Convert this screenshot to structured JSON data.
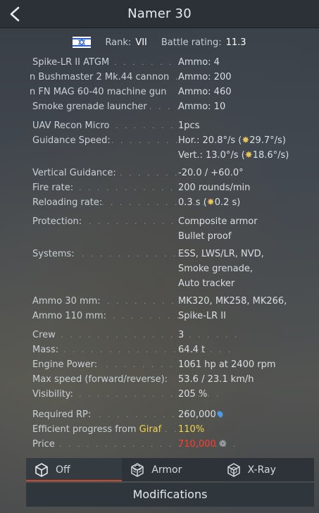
{
  "window": {
    "title": "Namer 30",
    "back_icon": "chevron-left-icon"
  },
  "header": {
    "flag_icon": "israel-flag-icon",
    "rank_label": "Rank:",
    "rank_value": "VII",
    "br_label": "Battle rating:",
    "br_value": "11.3"
  },
  "specs": {
    "weapons": [
      {
        "label": "Spike-LR II ATGM",
        "value": "Ammo:  4"
      },
      {
        "label": "n Bushmaster 2 Mk.44 cannon",
        "value": "Ammo:  200"
      },
      {
        "label": "n FN MAG 60-40 machine gun",
        "value": "Ammo:  460"
      },
      {
        "label": "Smoke grenade launcher",
        "value": "Ammo:  10"
      }
    ],
    "uav": {
      "label": "UAV Recon Micro",
      "value": "1pcs"
    },
    "guidance_speed": {
      "label": "Guidance Speed:",
      "value1": "Hor.: 20.8°/s (",
      "value1_b": "29.7°/s)",
      "value2": "Vert.: 13.0°/s (",
      "value2_b": "18.6°/s)"
    },
    "vertical_guidance": {
      "label": "Vertical Guidance:",
      "value": "-20.0 / +60.0°"
    },
    "fire_rate": {
      "label": "Fire rate:",
      "value": "200 rounds/min"
    },
    "reloading_rate": {
      "label": "Reloading rate:",
      "value": "0.3 s (",
      "value_b": "0.2 s)"
    },
    "protection": {
      "label": "Protection:",
      "value1": "Composite armor",
      "value2": "Bullet proof"
    },
    "systems": {
      "label": "Systems:",
      "value1": "ESS, LWS/LR, NVD,",
      "value2": "Smoke grenade,",
      "value3": "Auto tracker"
    },
    "ammo30": {
      "label": "Ammo 30 mm:",
      "value": "MK320, MK258, MK266,"
    },
    "ammo110": {
      "label": "Ammo 110 mm:",
      "value": "Spike-LR II"
    },
    "crew": {
      "label": "Crew",
      "value": "3"
    },
    "mass": {
      "label": "Mass:",
      "value": "64.4 t"
    },
    "engine_power": {
      "label": "Engine Power:",
      "value": "1061 hp at 2400 rpm"
    },
    "max_speed": {
      "label": "Max speed (forward/reverse):",
      "value": "53.6 / 23.1 km/h"
    },
    "visibility": {
      "label": "Visibility:",
      "value": "205 %"
    },
    "required_rp": {
      "label": "Required RP:",
      "value": "260,000"
    },
    "efficient_progress": {
      "label": "Efficient progress from ",
      "label_b": "Giraf",
      "value": "110%"
    },
    "price": {
      "label": "Price",
      "value": "710,000"
    }
  },
  "colors": {
    "highlight_yellow": "#f3d44a",
    "price_red": "#ff3b2f",
    "tab_active_underline": "#c7482e"
  },
  "tabs": [
    {
      "label": "Off",
      "icon": "cube-icon"
    },
    {
      "label": "Armor",
      "icon": "armor-cube-icon"
    },
    {
      "label": "X-Ray",
      "icon": "xray-cube-icon"
    }
  ],
  "footer": {
    "modifications_label": "Modifications"
  }
}
